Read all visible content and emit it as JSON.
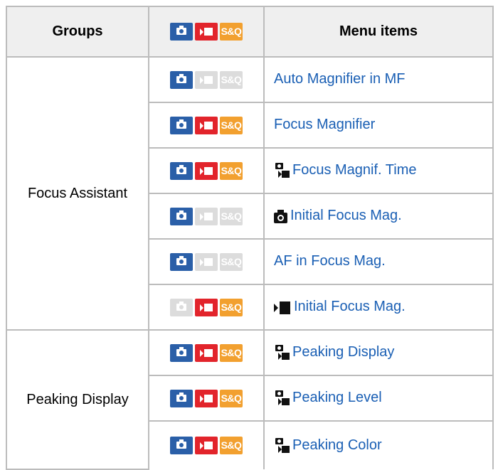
{
  "header": {
    "groups": "Groups",
    "menu_items": "Menu items",
    "mode_icons": [
      {
        "icon": "photo-mode-icon",
        "enabled": true
      },
      {
        "icon": "movie-mode-icon",
        "enabled": true
      },
      {
        "icon": "sq-mode-icon",
        "label": "S&Q",
        "enabled": true
      }
    ]
  },
  "colors": {
    "photo": "#2a5fa8",
    "movie": "#e2242b",
    "sq": "#f2a02f",
    "disabled": "#dcdcdc",
    "link": "#1a5fb4",
    "border": "#bcbcbc",
    "header_bg": "#efefef"
  },
  "groups": [
    {
      "name": "Focus Assistant",
      "rows": [
        {
          "modes": [
            true,
            false,
            false
          ],
          "prefix_icon": "",
          "label": "Auto Magnifier in MF"
        },
        {
          "modes": [
            true,
            true,
            true
          ],
          "prefix_icon": "",
          "label": "Focus Magnifier"
        },
        {
          "modes": [
            true,
            true,
            true
          ],
          "prefix_icon": "photo-movie-icon",
          "label": "Focus Magnif. Time"
        },
        {
          "modes": [
            true,
            false,
            false
          ],
          "prefix_icon": "photo-icon",
          "label": "Initial Focus Mag."
        },
        {
          "modes": [
            true,
            false,
            false
          ],
          "prefix_icon": "",
          "label": "AF in Focus Mag."
        },
        {
          "modes": [
            false,
            true,
            true
          ],
          "prefix_icon": "movie-icon",
          "label": "Initial Focus Mag."
        }
      ]
    },
    {
      "name": "Peaking Display",
      "rows": [
        {
          "modes": [
            true,
            true,
            true
          ],
          "prefix_icon": "photo-movie-icon",
          "label": "Peaking Display"
        },
        {
          "modes": [
            true,
            true,
            true
          ],
          "prefix_icon": "photo-movie-icon",
          "label": "Peaking Level"
        },
        {
          "modes": [
            true,
            true,
            true
          ],
          "prefix_icon": "photo-movie-icon",
          "label": "Peaking Color"
        }
      ]
    }
  ]
}
